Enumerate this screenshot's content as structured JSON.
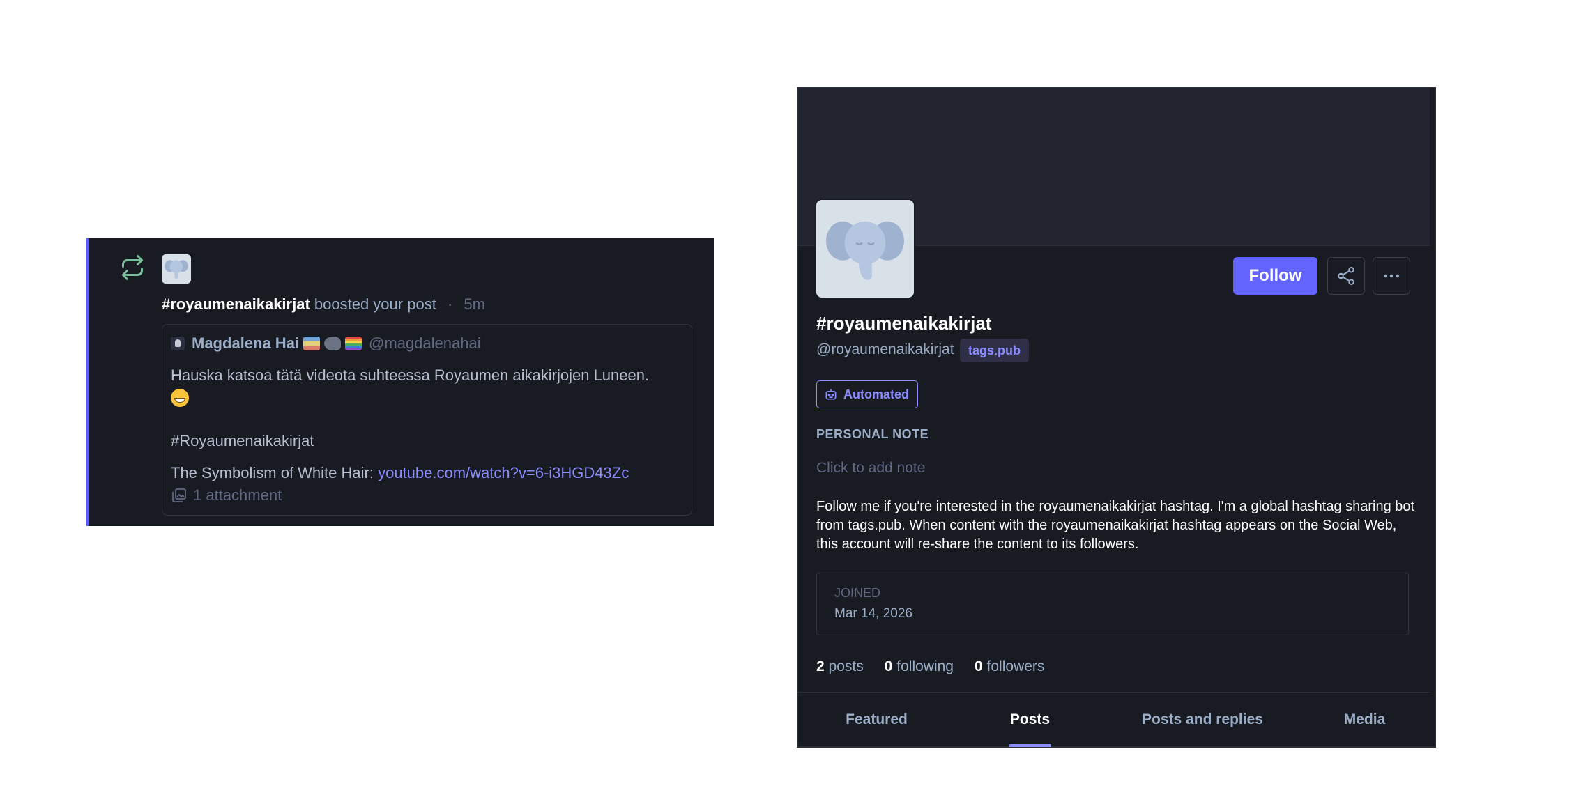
{
  "notification": {
    "account": "#royaumenaikakirjat",
    "action": "boosted your post",
    "separator": "·",
    "time": "5m",
    "status": {
      "author_name": "Magdalena Hai",
      "author_handle": "@magdalenahai",
      "text_line1": "Hauska katsoa tätä videota suhteessa Royaumen aikakirjojen Luneen.",
      "hashtag": "#Royaumenaikakirjat",
      "link_prefix": "The Symbolism of White Hair: ",
      "link_text": "youtube.com/watch?v=6-i3HGD43Zc",
      "attachments": "1 attachment"
    }
  },
  "profile": {
    "display_name": "#royaumenaikakirjat",
    "acct": "@royaumenaikakirjat",
    "domain_badge": "tags.pub",
    "follow_label": "Follow",
    "automated_label": "Automated",
    "note_label": "PERSONAL NOTE",
    "note_placeholder": "Click to add note",
    "bio": "Follow me if you're interested in the royaumenaikakirjat hashtag. I'm a global hashtag sharing bot from tags.pub. When content with the royaumenaikakirjat hashtag appears on the Social Web, this account will re-share the content to its followers.",
    "joined_label": "JOINED",
    "joined_date": "Mar 14, 2026",
    "posts_count": "2",
    "posts_label": "posts",
    "following_count": "0",
    "following_label": "following",
    "followers_count": "0",
    "followers_label": "followers",
    "tabs": [
      "Featured",
      "Posts",
      "Posts and replies",
      "Media"
    ],
    "active_tab": "Posts"
  },
  "colors": {
    "background": "#191b22",
    "accent": "#6364ff",
    "link": "#8c8dff",
    "boost": "#79bd9a"
  }
}
